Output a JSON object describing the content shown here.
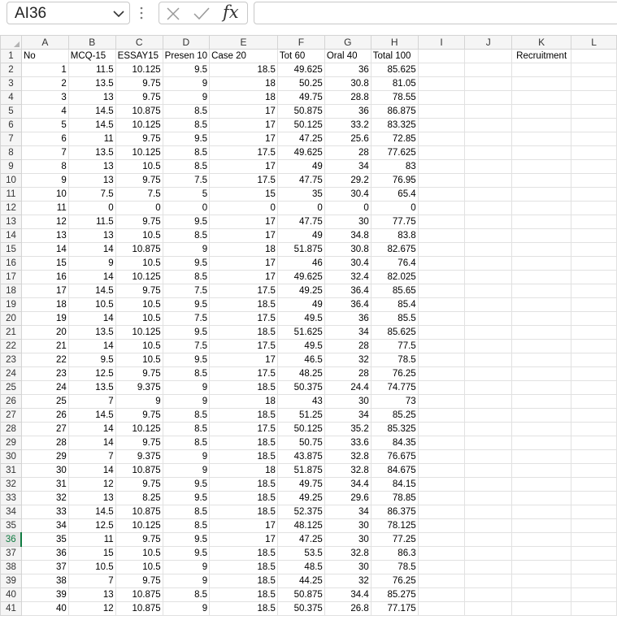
{
  "formula_bar": {
    "name_box": "AI36",
    "formula": ""
  },
  "columns": [
    "A",
    "B",
    "C",
    "D",
    "E",
    "F",
    "G",
    "H",
    "I",
    "J",
    "K",
    "L"
  ],
  "header_row": [
    "No",
    "MCQ-15",
    "ESSAY15",
    "Presen 10",
    "Case 20",
    "Tot 60",
    "Oral 40",
    "Total 100",
    "",
    "",
    "Recruitment",
    ""
  ],
  "rows": [
    [
      "1",
      "11.5",
      "10.125",
      "9.5",
      "18.5",
      "49.625",
      "36",
      "85.625"
    ],
    [
      "2",
      "13.5",
      "9.75",
      "9",
      "18",
      "50.25",
      "30.8",
      "81.05"
    ],
    [
      "3",
      "13",
      "9.75",
      "9",
      "18",
      "49.75",
      "28.8",
      "78.55"
    ],
    [
      "4",
      "14.5",
      "10.875",
      "8.5",
      "17",
      "50.875",
      "36",
      "86.875"
    ],
    [
      "5",
      "14.5",
      "10.125",
      "8.5",
      "17",
      "50.125",
      "33.2",
      "83.325"
    ],
    [
      "6",
      "11",
      "9.75",
      "9.5",
      "17",
      "47.25",
      "25.6",
      "72.85"
    ],
    [
      "7",
      "13.5",
      "10.125",
      "8.5",
      "17.5",
      "49.625",
      "28",
      "77.625"
    ],
    [
      "8",
      "13",
      "10.5",
      "8.5",
      "17",
      "49",
      "34",
      "83"
    ],
    [
      "9",
      "13",
      "9.75",
      "7.5",
      "17.5",
      "47.75",
      "29.2",
      "76.95"
    ],
    [
      "10",
      "7.5",
      "7.5",
      "5",
      "15",
      "35",
      "30.4",
      "65.4"
    ],
    [
      "11",
      "0",
      "0",
      "0",
      "0",
      "0",
      "0",
      "0"
    ],
    [
      "12",
      "11.5",
      "9.75",
      "9.5",
      "17",
      "47.75",
      "30",
      "77.75"
    ],
    [
      "13",
      "13",
      "10.5",
      "8.5",
      "17",
      "49",
      "34.8",
      "83.8"
    ],
    [
      "14",
      "14",
      "10.875",
      "9",
      "18",
      "51.875",
      "30.8",
      "82.675"
    ],
    [
      "15",
      "9",
      "10.5",
      "9.5",
      "17",
      "46",
      "30.4",
      "76.4"
    ],
    [
      "16",
      "14",
      "10.125",
      "8.5",
      "17",
      "49.625",
      "32.4",
      "82.025"
    ],
    [
      "17",
      "14.5",
      "9.75",
      "7.5",
      "17.5",
      "49.25",
      "36.4",
      "85.65"
    ],
    [
      "18",
      "10.5",
      "10.5",
      "9.5",
      "18.5",
      "49",
      "36.4",
      "85.4"
    ],
    [
      "19",
      "14",
      "10.5",
      "7.5",
      "17.5",
      "49.5",
      "36",
      "85.5"
    ],
    [
      "20",
      "13.5",
      "10.125",
      "9.5",
      "18.5",
      "51.625",
      "34",
      "85.625"
    ],
    [
      "21",
      "14",
      "10.5",
      "7.5",
      "17.5",
      "49.5",
      "28",
      "77.5"
    ],
    [
      "22",
      "9.5",
      "10.5",
      "9.5",
      "17",
      "46.5",
      "32",
      "78.5"
    ],
    [
      "23",
      "12.5",
      "9.75",
      "8.5",
      "17.5",
      "48.25",
      "28",
      "76.25"
    ],
    [
      "24",
      "13.5",
      "9.375",
      "9",
      "18.5",
      "50.375",
      "24.4",
      "74.775"
    ],
    [
      "25",
      "7",
      "9",
      "9",
      "18",
      "43",
      "30",
      "73"
    ],
    [
      "26",
      "14.5",
      "9.75",
      "8.5",
      "18.5",
      "51.25",
      "34",
      "85.25"
    ],
    [
      "27",
      "14",
      "10.125",
      "8.5",
      "17.5",
      "50.125",
      "35.2",
      "85.325"
    ],
    [
      "28",
      "14",
      "9.75",
      "8.5",
      "18.5",
      "50.75",
      "33.6",
      "84.35"
    ],
    [
      "29",
      "7",
      "9.375",
      "9",
      "18.5",
      "43.875",
      "32.8",
      "76.675"
    ],
    [
      "30",
      "14",
      "10.875",
      "9",
      "18",
      "51.875",
      "32.8",
      "84.675"
    ],
    [
      "31",
      "12",
      "9.75",
      "9.5",
      "18.5",
      "49.75",
      "34.4",
      "84.15"
    ],
    [
      "32",
      "13",
      "8.25",
      "9.5",
      "18.5",
      "49.25",
      "29.6",
      "78.85"
    ],
    [
      "33",
      "14.5",
      "10.875",
      "8.5",
      "18.5",
      "52.375",
      "34",
      "86.375"
    ],
    [
      "34",
      "12.5",
      "10.125",
      "8.5",
      "17",
      "48.125",
      "30",
      "78.125"
    ],
    [
      "35",
      "11",
      "9.75",
      "9.5",
      "17",
      "47.25",
      "30",
      "77.25"
    ],
    [
      "36",
      "15",
      "10.5",
      "9.5",
      "18.5",
      "53.5",
      "32.8",
      "86.3"
    ],
    [
      "37",
      "10.5",
      "10.5",
      "9",
      "18.5",
      "48.5",
      "30",
      "78.5"
    ],
    [
      "38",
      "7",
      "9.75",
      "9",
      "18.5",
      "44.25",
      "32",
      "76.25"
    ],
    [
      "39",
      "13",
      "10.875",
      "8.5",
      "18.5",
      "50.875",
      "34.4",
      "85.275"
    ],
    [
      "40",
      "12",
      "10.875",
      "9",
      "18.5",
      "50.375",
      "26.8",
      "77.175"
    ]
  ],
  "active_row": 36
}
